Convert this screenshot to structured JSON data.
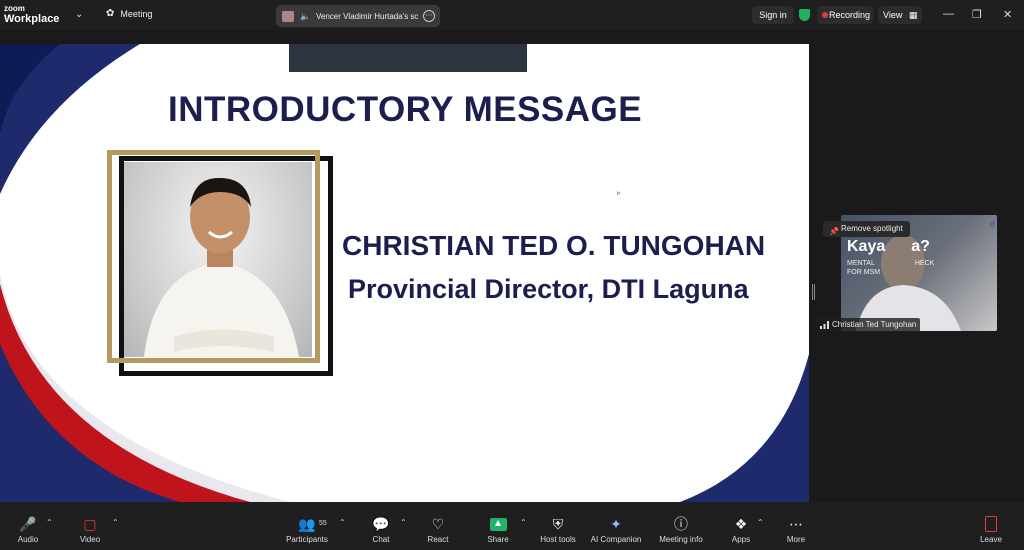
{
  "titlebar": {
    "logo_top": "zoom",
    "logo_bottom": "Workplace",
    "meeting_tab": "Meeting",
    "share_tab": "Vencer Vladimir Hurtada's sc",
    "signin": "Sign in",
    "recording": "Recording",
    "view": "View"
  },
  "slide": {
    "title": "INTRODUCTORY MESSAGE",
    "name": "CHRISTIAN TED O. TUNGOHAN",
    "role": "Provincial Director, DTI Laguna"
  },
  "participant_tile": {
    "remove_spotlight": "Remove spotlight",
    "name": "Christian Ted Tungohan",
    "bg_text_large": "Kaya",
    "bg_text_suffix": "a?",
    "bg_text_line1": "MENTAL",
    "bg_text_line1b": "HECK",
    "bg_text_line2": "FOR MSM",
    "logo": "d"
  },
  "toolbar": {
    "audio": "Audio",
    "video": "Video",
    "participants": "Participants",
    "participants_count": "55",
    "chat": "Chat",
    "react": "React",
    "share": "Share",
    "host_tools": "Host tools",
    "ai_companion": "AI Companion",
    "meeting_info": "Meeting info",
    "apps": "Apps",
    "more": "More",
    "leave": "Leave"
  },
  "colors": {
    "slide_navy": "#1c1e4d",
    "gold_frame": "#b49a5e",
    "recording_red": "#e23b3b",
    "share_green": "#22b36b"
  }
}
